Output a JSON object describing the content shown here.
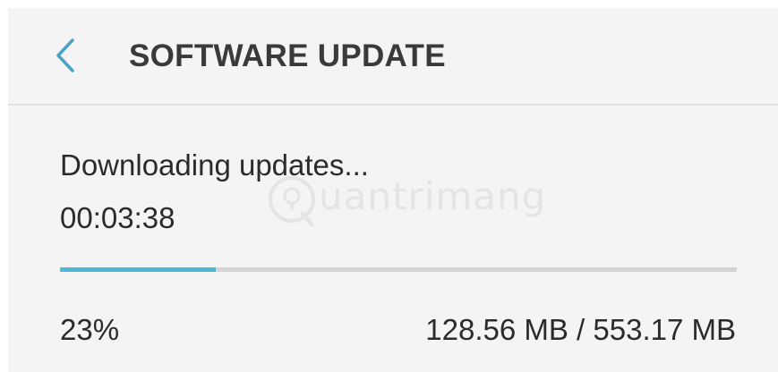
{
  "header": {
    "title": "SOFTWARE UPDATE",
    "back_icon": "chevron-left-icon"
  },
  "download": {
    "status": "Downloading updates...",
    "elapsed": "00:03:38",
    "progress_percent": 23,
    "percent_label": "23%",
    "size_label": "128.56 MB / 553.17 MB"
  },
  "watermark": {
    "text": "uantrimang"
  },
  "colors": {
    "accent": "#4fb7d6",
    "track": "#d4d4d4",
    "background": "#f4f4f4",
    "text": "#2b2b2b"
  }
}
